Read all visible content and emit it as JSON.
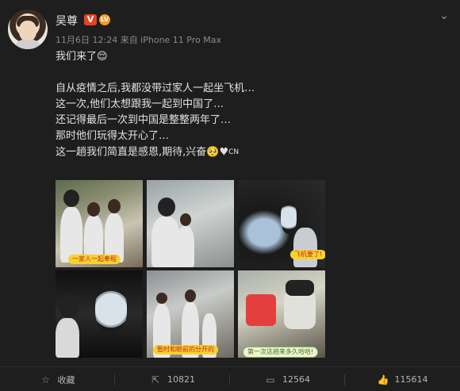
{
  "post": {
    "username": "吴尊",
    "badge_v": "V",
    "badge_level": "LV",
    "meta": "11月6日 12:24 来自 iPhone 11 Pro Max",
    "lines": [
      "我们来了😌",
      "",
      "自从疫情之后,我都没带过家人一起坐飞机…",
      "这一次,他们太想跟我一起到中国了…",
      "还记得最后一次到中国是整整两年了…",
      "那时他们玩得太开心了…",
      "这一趟我们简直是感恩,期待,兴奋🥺♥"
    ],
    "line_suffix": "CN",
    "photo_tags": {
      "tile1": "一家人一起奉程",
      "tile3": "飞机要了!",
      "tile5": "暂时和眼前的分开的",
      "tile6": "第一次这趟来多久哈哈!"
    }
  },
  "actions": {
    "favorite": {
      "label": "收藏",
      "icon": "star-icon"
    },
    "repost": {
      "count": "10821",
      "icon": "repost-icon"
    },
    "comment": {
      "count": "12564",
      "icon": "comment-icon"
    },
    "like": {
      "count": "115614",
      "icon": "thumbs-up-icon"
    }
  },
  "colors": {
    "background": "#1e1e1e",
    "text": "#e1e1e1",
    "meta": "#8a8a8a",
    "badge_v": "#e8411f",
    "badge_level": "#f59a24"
  }
}
